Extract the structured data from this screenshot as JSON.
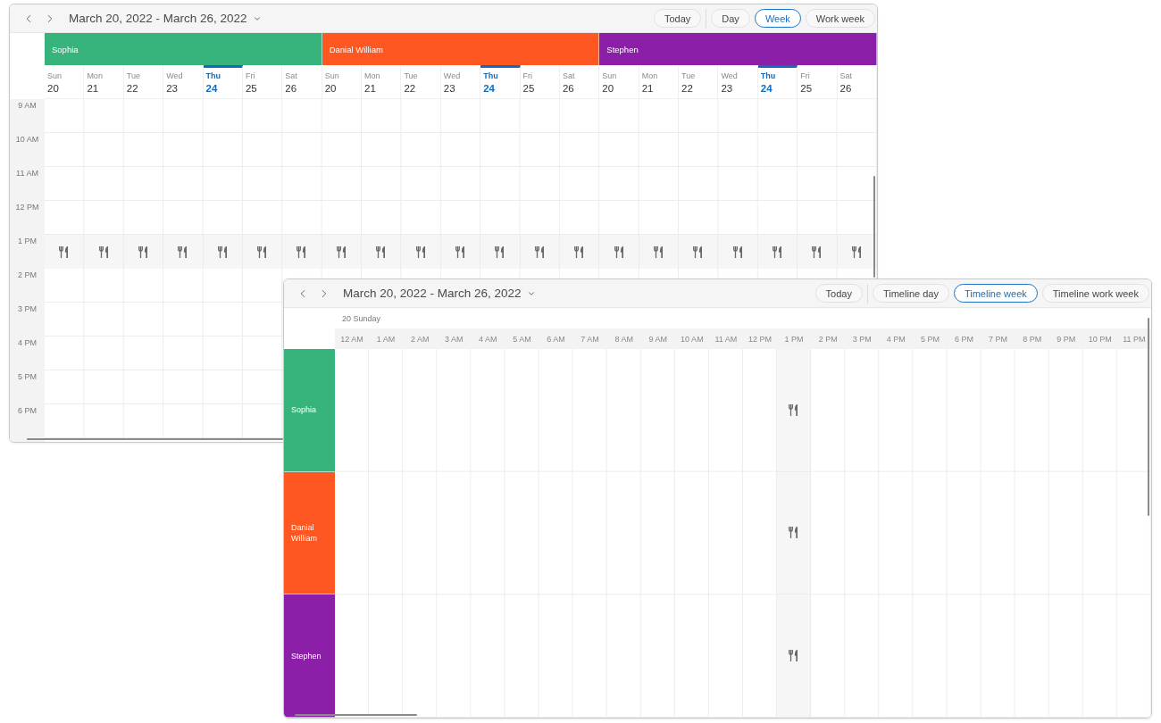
{
  "week_view": {
    "toolbar": {
      "date_range": "March 20, 2022 - March 26, 2022",
      "today": "Today",
      "views": [
        {
          "label": "Day",
          "selected": false
        },
        {
          "label": "Week",
          "selected": true
        },
        {
          "label": "Work week",
          "selected": false
        }
      ]
    },
    "resources": [
      {
        "name": "Sophia",
        "color": "#37b37c",
        "days": [
          {
            "weekday": "Sun",
            "date": "20",
            "today": false
          },
          {
            "weekday": "Mon",
            "date": "21",
            "today": false
          },
          {
            "weekday": "Tue",
            "date": "22",
            "today": false
          },
          {
            "weekday": "Wed",
            "date": "23",
            "today": false
          },
          {
            "weekday": "Thu",
            "date": "24",
            "today": true
          },
          {
            "weekday": "Fri",
            "date": "25",
            "today": false
          },
          {
            "weekday": "Sat",
            "date": "26",
            "today": false
          }
        ]
      },
      {
        "name": "Danial William",
        "color": "#fe5722",
        "days": [
          {
            "weekday": "Sun",
            "date": "20",
            "today": false
          },
          {
            "weekday": "Mon",
            "date": "21",
            "today": false
          },
          {
            "weekday": "Tue",
            "date": "22",
            "today": false
          },
          {
            "weekday": "Wed",
            "date": "23",
            "today": false
          },
          {
            "weekday": "Thu",
            "date": "24",
            "today": true
          },
          {
            "weekday": "Fri",
            "date": "25",
            "today": false
          },
          {
            "weekday": "Sat",
            "date": "26",
            "today": false
          }
        ]
      },
      {
        "name": "Stephen",
        "color": "#8b1fa8",
        "days": [
          {
            "weekday": "Sun",
            "date": "20",
            "today": false
          },
          {
            "weekday": "Mon",
            "date": "21",
            "today": false
          },
          {
            "weekday": "Tue",
            "date": "22",
            "today": false
          },
          {
            "weekday": "Wed",
            "date": "23",
            "today": false
          },
          {
            "weekday": "Thu",
            "date": "24",
            "today": true
          },
          {
            "weekday": "Fri",
            "date": "25",
            "today": false
          },
          {
            "weekday": "Sat",
            "date": "26",
            "today": false
          }
        ]
      }
    ],
    "time_slots": [
      {
        "label": "9 AM",
        "kind": "work"
      },
      {
        "label": "10 AM",
        "kind": "work"
      },
      {
        "label": "11 AM",
        "kind": "work"
      },
      {
        "label": "12 PM",
        "kind": "work"
      },
      {
        "label": "1 PM",
        "kind": "break"
      },
      {
        "label": "2 PM",
        "kind": "work"
      },
      {
        "label": "3 PM",
        "kind": "work"
      },
      {
        "label": "4 PM",
        "kind": "work"
      },
      {
        "label": "5 PM",
        "kind": "work"
      },
      {
        "label": "6 PM",
        "kind": "work"
      }
    ]
  },
  "timeline_view": {
    "toolbar": {
      "date_range": "March 20, 2022 - March 26, 2022",
      "today": "Today",
      "views": [
        {
          "label": "Timeline day",
          "selected": false
        },
        {
          "label": "Timeline week",
          "selected": true
        },
        {
          "label": "Timeline work week",
          "selected": false
        }
      ]
    },
    "day_label": "20 Sunday",
    "hours": [
      {
        "label": "12 AM",
        "kind": "work"
      },
      {
        "label": "1 AM",
        "kind": "work"
      },
      {
        "label": "2 AM",
        "kind": "work"
      },
      {
        "label": "3 AM",
        "kind": "work"
      },
      {
        "label": "4 AM",
        "kind": "work"
      },
      {
        "label": "5 AM",
        "kind": "work"
      },
      {
        "label": "6 AM",
        "kind": "work"
      },
      {
        "label": "7 AM",
        "kind": "work"
      },
      {
        "label": "8 AM",
        "kind": "work"
      },
      {
        "label": "9 AM",
        "kind": "work"
      },
      {
        "label": "10 AM",
        "kind": "work"
      },
      {
        "label": "11 AM",
        "kind": "work"
      },
      {
        "label": "12 PM",
        "kind": "work"
      },
      {
        "label": "1 PM",
        "kind": "break"
      },
      {
        "label": "2 PM",
        "kind": "work"
      },
      {
        "label": "3 PM",
        "kind": "work"
      },
      {
        "label": "4 PM",
        "kind": "work"
      },
      {
        "label": "5 PM",
        "kind": "work"
      },
      {
        "label": "6 PM",
        "kind": "work"
      },
      {
        "label": "7 PM",
        "kind": "work"
      },
      {
        "label": "8 PM",
        "kind": "work"
      },
      {
        "label": "9 PM",
        "kind": "work"
      },
      {
        "label": "10 PM",
        "kind": "work"
      },
      {
        "label": "11 PM",
        "kind": "work"
      }
    ],
    "resources": [
      {
        "name": "Sophia",
        "color": "#37b37c"
      },
      {
        "name": "Danial William",
        "color": "#fe5722"
      },
      {
        "name": "Stephen",
        "color": "#8b1fa8"
      }
    ]
  }
}
